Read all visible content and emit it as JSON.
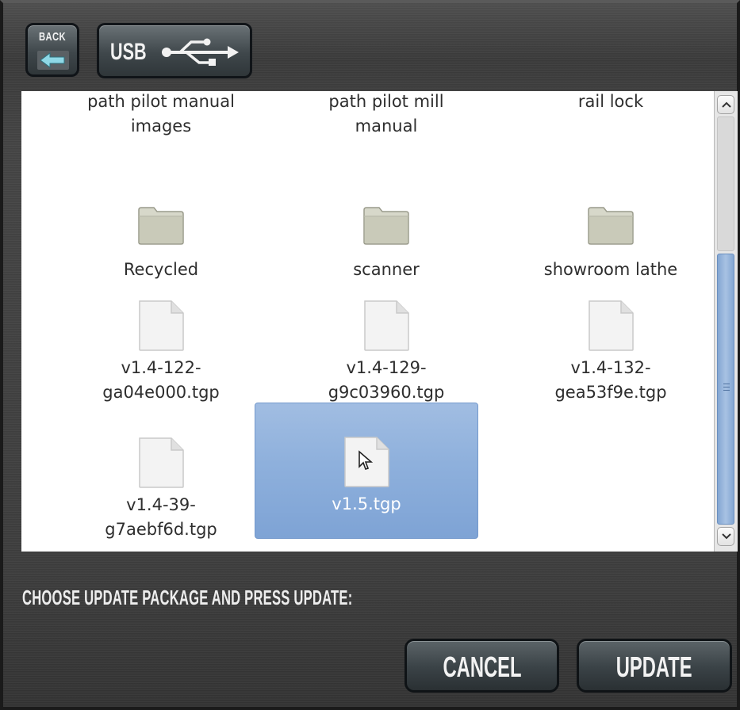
{
  "toolbar": {
    "back_label": "BACK",
    "usb_label": "USB",
    "back_icon": "arrow-left-icon",
    "usb_icon": "usb-icon"
  },
  "files": [
    {
      "name": "path pilot manual images",
      "type": "folder",
      "icon": "folder-icon"
    },
    {
      "name": "path pilot mill manual",
      "type": "folder",
      "icon": "folder-icon"
    },
    {
      "name": "rail lock",
      "type": "folder",
      "icon": "folder-icon"
    },
    {
      "name": "Recycled",
      "type": "folder",
      "icon": "folder-icon"
    },
    {
      "name": "scanner",
      "type": "folder",
      "icon": "folder-icon"
    },
    {
      "name": "showroom lathe",
      "type": "folder",
      "icon": "folder-icon"
    },
    {
      "name": "v1.4-122-ga04e000.tgp",
      "type": "file",
      "icon": "file-icon"
    },
    {
      "name": "v1.4-129-g9c03960.tgp",
      "type": "file",
      "icon": "file-icon"
    },
    {
      "name": "v1.4-132-gea53f9e.tgp",
      "type": "file",
      "icon": "file-icon"
    },
    {
      "name": "v1.4-39-g7aebf6d.tgp",
      "type": "file",
      "icon": "file-icon"
    },
    {
      "name": "v1.5.tgp",
      "type": "file",
      "icon": "file-icon",
      "selected": true
    }
  ],
  "file_lines": [
    [
      "path pilot manual",
      "images"
    ],
    [
      "path pilot mill",
      "manual"
    ],
    [
      "rail lock"
    ],
    [
      "Recycled"
    ],
    [
      "scanner"
    ],
    [
      "showroom lathe"
    ],
    [
      "v1.4-122-",
      "ga04e000.tgp"
    ],
    [
      "v1.4-129-",
      "g9c03960.tgp"
    ],
    [
      "v1.4-132-",
      "gea53f9e.tgp"
    ],
    [
      "v1.4-39-",
      "g7aebf6d.tgp"
    ],
    [
      "v1.5.tgp"
    ]
  ],
  "scrollbar": {
    "position_fraction": 0.62
  },
  "prompt": "CHOOSE UPDATE PACKAGE AND PRESS UPDATE:",
  "actions": {
    "cancel_label": "CANCEL",
    "update_label": "UPDATE"
  },
  "colors": {
    "selection": "#8eb0dc",
    "scroll_thumb": "#a8c2e3",
    "background": "#3d3d3d"
  }
}
